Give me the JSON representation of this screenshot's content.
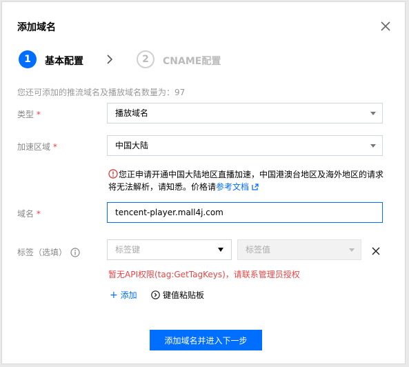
{
  "dialog": {
    "title": "添加域名"
  },
  "steps": [
    {
      "number": "1",
      "label": "基本配置",
      "state": "active"
    },
    {
      "number": "2",
      "label": "CNAME配置",
      "state": "pending"
    }
  ],
  "quota_hint": "您还可添加的推流域名及播放域名数量为：97",
  "form": {
    "type": {
      "label": "类型",
      "required_mark": "*",
      "value": "播放域名"
    },
    "region": {
      "label": "加速区域",
      "required_mark": "*",
      "value": "中国大陆"
    },
    "warning": {
      "text": "您正申请开通中国大陆地区直播加速，中国港澳台地区及海外地区的请求将无法解析，请知悉。价格请",
      "link_text": "参考文档"
    },
    "domain": {
      "label": "域名",
      "required_mark": "*",
      "value": "tencent-player.mall4j.com"
    },
    "tags": {
      "label": "标签（选填）",
      "key_placeholder": "标签键",
      "value_placeholder": "标签值",
      "error": "暂无API权限(tag:GetTagKeys)，请联系管理员授权",
      "add_label": "添加",
      "paste_label": "键值粘贴板"
    }
  },
  "footer": {
    "submit_label": "添加域名并进入下一步"
  },
  "colors": {
    "primary": "#006eff",
    "error": "#e54545",
    "muted": "#999999"
  }
}
